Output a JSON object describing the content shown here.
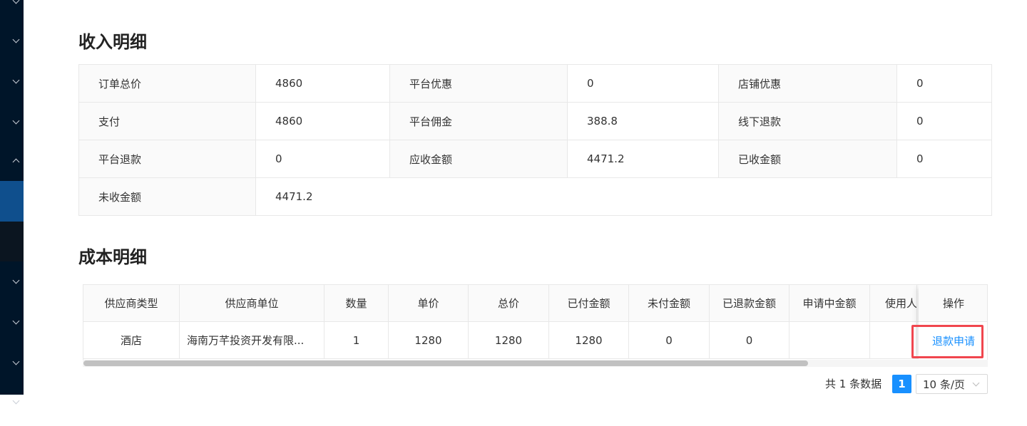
{
  "income": {
    "title": "收入明细",
    "rows": [
      [
        {
          "label": "订单总价",
          "value": "4860"
        },
        {
          "label": "平台优惠",
          "value": "0"
        },
        {
          "label": "店铺优惠",
          "value": "0"
        }
      ],
      [
        {
          "label": "支付",
          "value": "4860"
        },
        {
          "label": "平台佣金",
          "value": "388.8"
        },
        {
          "label": "线下退款",
          "value": "0"
        }
      ],
      [
        {
          "label": "平台退款",
          "value": "0"
        },
        {
          "label": "应收金额",
          "value": "4471.2"
        },
        {
          "label": "已收金额",
          "value": "0"
        }
      ],
      [
        {
          "label": "未收金额",
          "value": "4471.2"
        }
      ]
    ]
  },
  "cost": {
    "title": "成本明细",
    "columns": [
      "供应商类型",
      "供应商单位",
      "数量",
      "单价",
      "总价",
      "已付金额",
      "未付金额",
      "已退款金额",
      "申请中金额",
      "使用人",
      "操作"
    ],
    "rows": [
      {
        "supplier_type": "酒店",
        "supplier_unit": "海南万芊投资开发有限...",
        "quantity": "1",
        "unit_price": "1280",
        "total": "1280",
        "paid": "1280",
        "unpaid": "0",
        "refunded": "0",
        "applying": "",
        "user": "",
        "action": "退款申请"
      }
    ]
  },
  "pagination": {
    "total_text": "共 1 条数据",
    "current_page": "1",
    "page_size": "10 条/页"
  },
  "colors": {
    "sidebar": "#001529",
    "sidebar_active": "#0f4f8d",
    "link": "#1890ff",
    "highlight": "#f0464e"
  }
}
